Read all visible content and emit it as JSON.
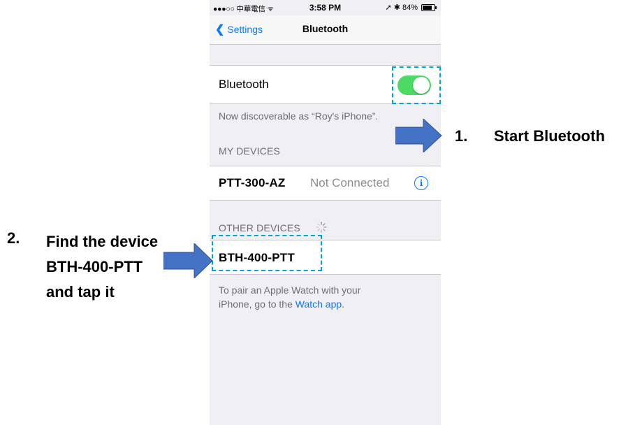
{
  "status_bar": {
    "carrier": "●●●○○ 中華電信 ᯤ",
    "time": "3:58 PM",
    "right": "➚ ✱ 84%"
  },
  "nav": {
    "back_label": "Settings",
    "title": "Bluetooth"
  },
  "bluetooth": {
    "label": "Bluetooth",
    "enabled": true,
    "discoverable_text": "Now discoverable as “Roy's iPhone”."
  },
  "my_devices": {
    "header": "MY DEVICES",
    "items": [
      {
        "name": "PTT-300-AZ",
        "status": "Not Connected"
      }
    ]
  },
  "other_devices": {
    "header": "OTHER DEVICES",
    "items": [
      {
        "name": "BTH-400-PTT"
      }
    ]
  },
  "watch_footer": {
    "line1": "To pair an Apple Watch with your",
    "line2_prefix": "iPhone, go to the ",
    "link": "Watch app",
    "line2_suffix": "."
  },
  "annotations": {
    "step1_number": "1.",
    "step1_text": "Start Bluetooth",
    "step2_number": "2.",
    "step2_line1": "Find the device",
    "step2_line2": "BTH-400-PTT",
    "step2_line3": "and tap it"
  },
  "colors": {
    "accent": "#0a7aff",
    "toggle_on": "#4cd964",
    "highlight": "#00a6d6",
    "arrow": "#4472c4"
  },
  "icons": [
    "chevron-left-icon",
    "info-icon",
    "spinner-icon",
    "arrow-right-icon",
    "battery-icon"
  ]
}
